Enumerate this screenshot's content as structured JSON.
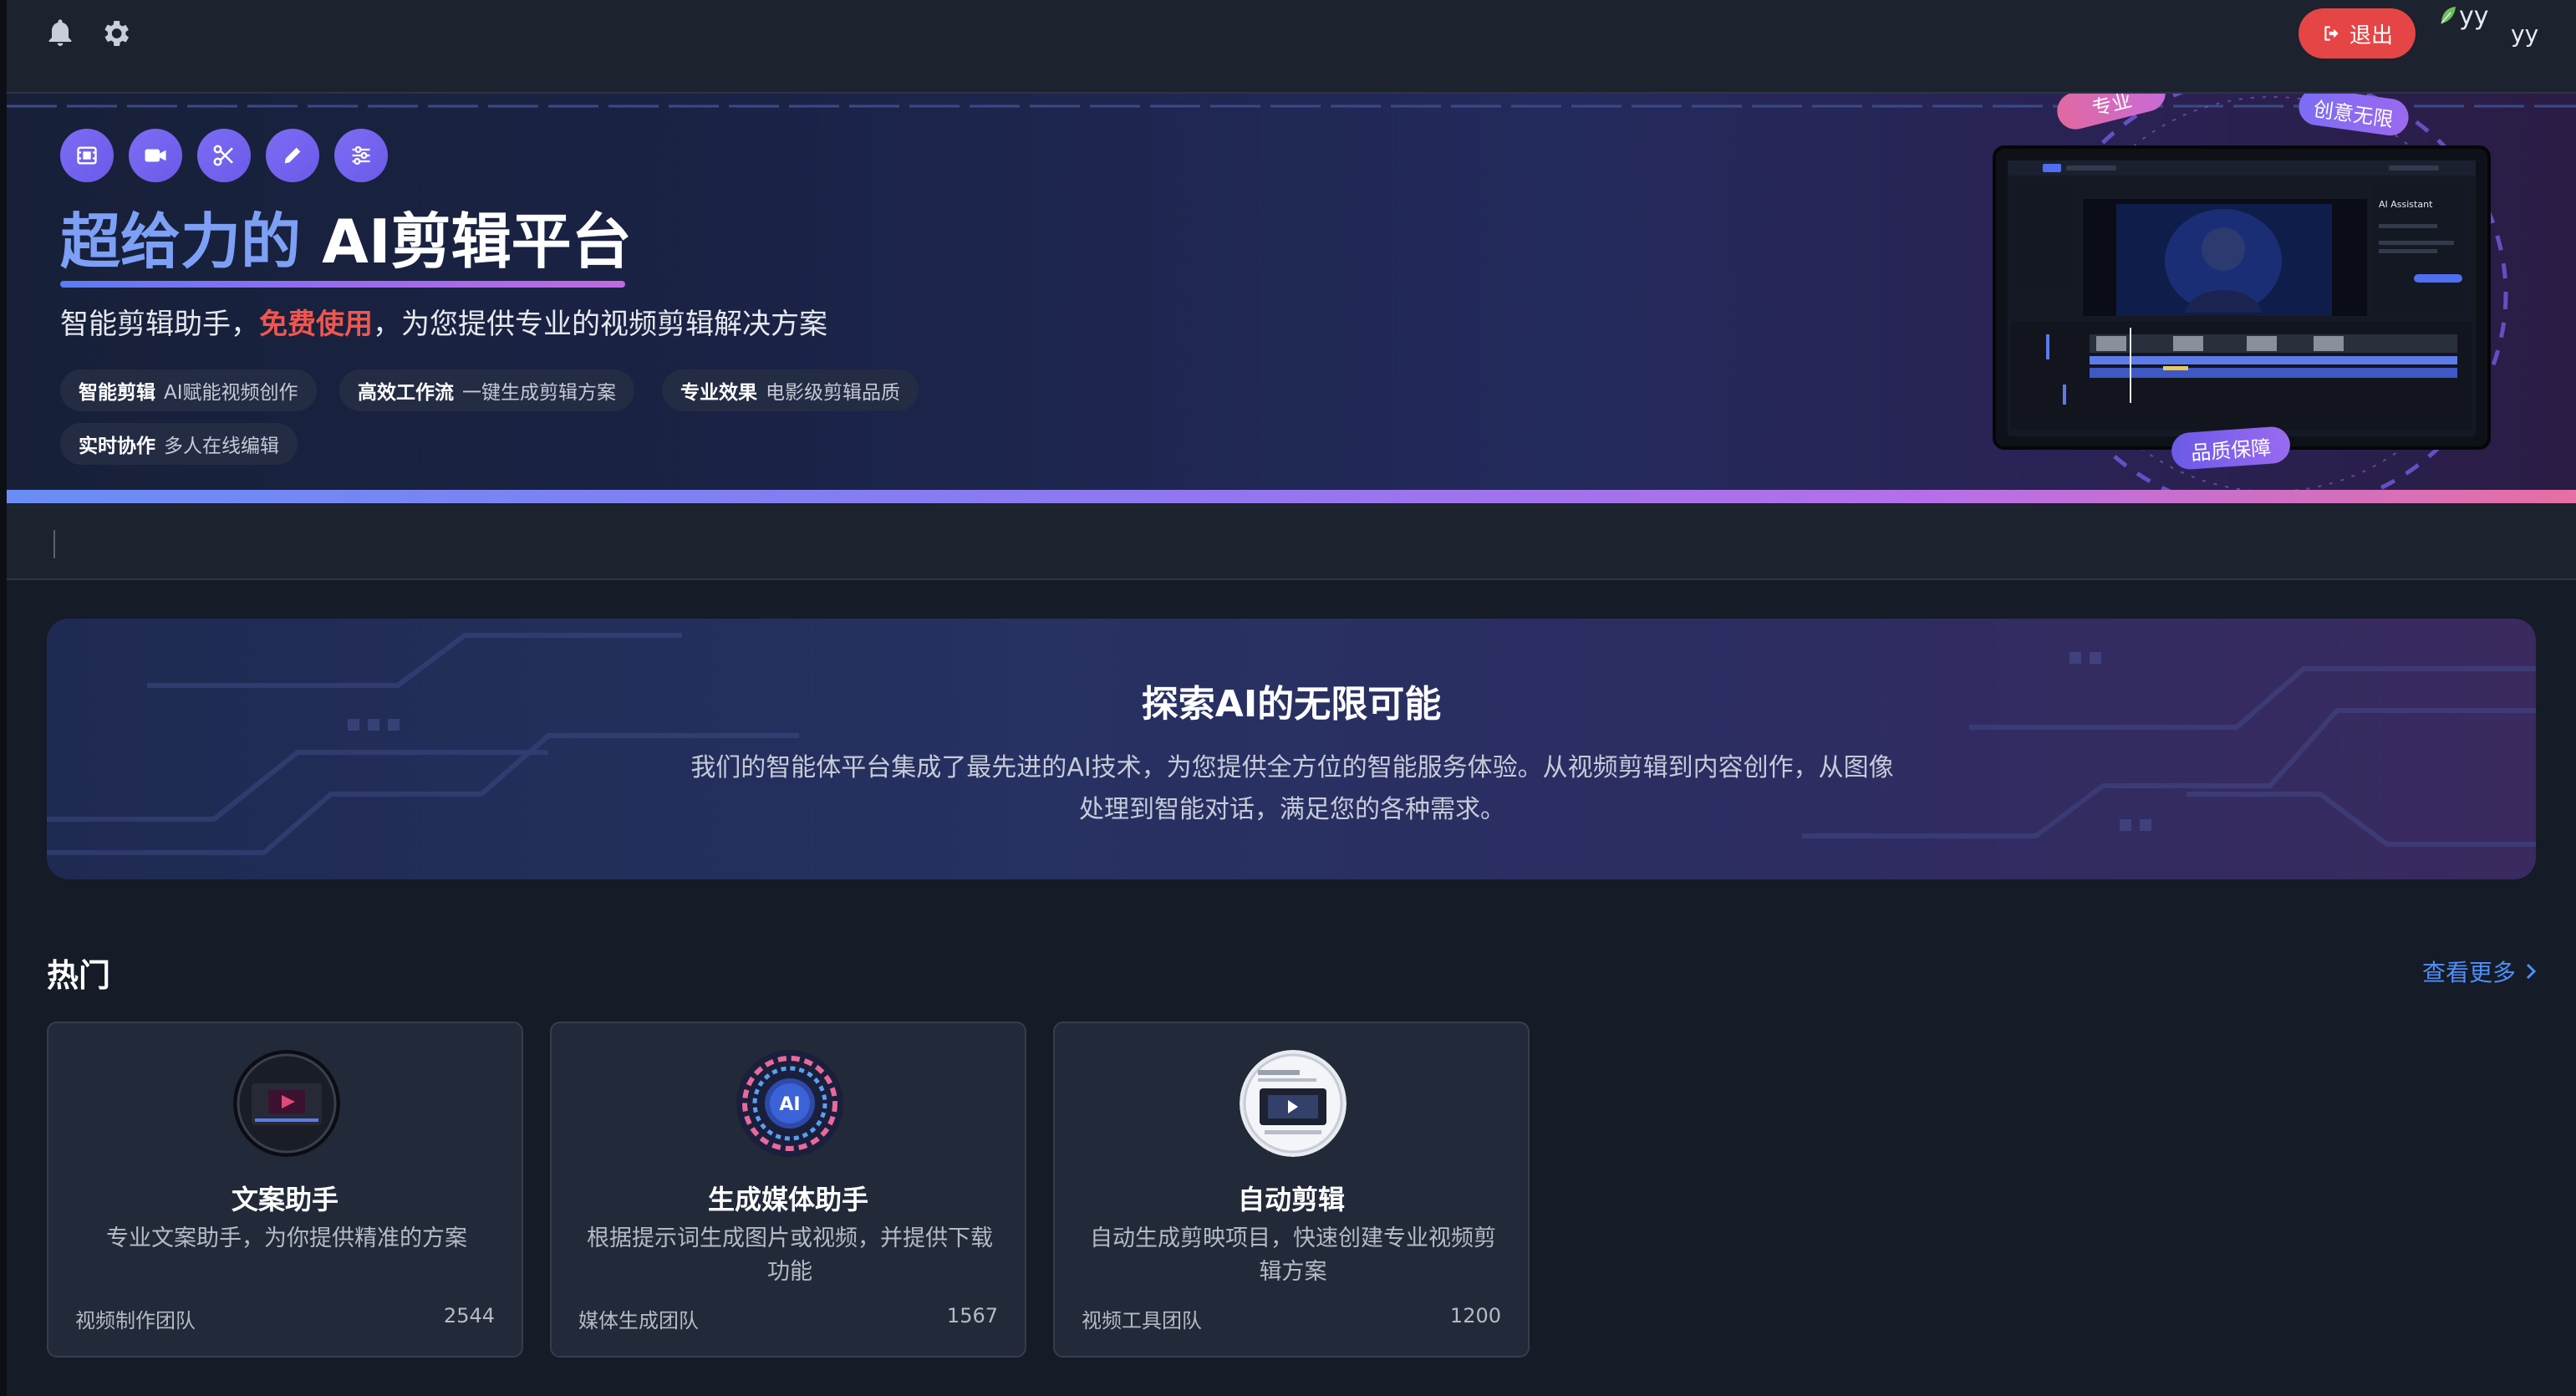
{
  "header": {
    "logout_label": "退出",
    "avatar_alt": "yy",
    "username": "yy",
    "notification_icon": "bell-icon",
    "settings_icon": "gear-icon"
  },
  "hero": {
    "tool_icons": [
      "film-icon",
      "video-camera-icon",
      "scissors-icon",
      "pencil-icon",
      "sliders-icon"
    ],
    "title_highlight": "超给力的",
    "title_rest": "AI剪辑平台",
    "subtitle_before": "智能剪辑助手，",
    "subtitle_highlight": "免费使用",
    "subtitle_after": "，为您提供专业的视频剪辑解决方案",
    "features": [
      {
        "name": "智能剪辑",
        "desc": "AI赋能视频创作"
      },
      {
        "name": "高效工作流",
        "desc": "一键生成剪辑方案"
      },
      {
        "name": "专业效果",
        "desc": "电影级剪辑品质"
      },
      {
        "name": "实时协作",
        "desc": "多人在线编辑"
      }
    ],
    "badges": {
      "top_left": "专业",
      "top_right": "创意无限",
      "bottom": "品质保障"
    },
    "preview_panel_title": "AI Assistant"
  },
  "explore": {
    "title": "探索AI的无限可能",
    "description": "我们的智能体平台集成了最先进的AI技术，为您提供全方位的智能服务体验。从视频剪辑到内容创作，从图像处理到智能对话，满足您的各种需求。"
  },
  "hot": {
    "title": "热门",
    "more_label": "查看更多",
    "cards": [
      {
        "title": "文案助手",
        "desc": "专业文案助手，为你提供精准的方案",
        "team": "视频制作团队",
        "count": "2544"
      },
      {
        "title": "生成媒体助手",
        "desc": "根据提示词生成图片或视频，并提供下载功能",
        "team": "媒体生成团队",
        "count": "1567"
      },
      {
        "title": "自动剪辑",
        "desc": "自动生成剪映项目，快速创建专业视频剪辑方案",
        "team": "视频工具团队",
        "count": "1200"
      }
    ]
  },
  "colors": {
    "accent": "#7d6cf4",
    "danger": "#e54545",
    "link": "#4f8ef7",
    "background": "#151b27"
  }
}
